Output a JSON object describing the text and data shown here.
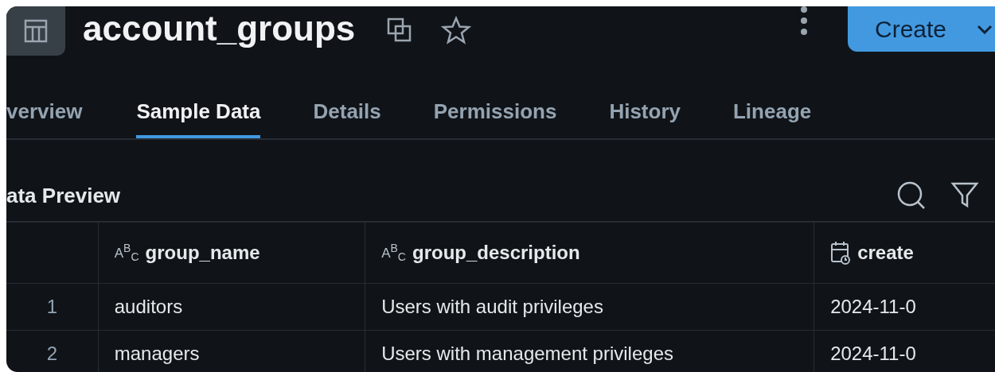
{
  "header": {
    "title": "account_groups",
    "create_button": "Create"
  },
  "tabs": [
    {
      "label": "verview",
      "selected": false
    },
    {
      "label": "Sample Data",
      "selected": true
    },
    {
      "label": "Details",
      "selected": false
    },
    {
      "label": "Permissions",
      "selected": false
    },
    {
      "label": "History",
      "selected": false
    },
    {
      "label": "Lineage",
      "selected": false
    }
  ],
  "section_title": "ata Preview",
  "table": {
    "columns": [
      {
        "label": "group_name",
        "kind": "text",
        "type_glyph": "A$^{B}$$_{C}$"
      },
      {
        "label": "group_description",
        "kind": "text",
        "type_glyph": "A$^{B}$$_{C}$"
      },
      {
        "label": "create",
        "kind": "date"
      }
    ],
    "rows": [
      {
        "index": "1",
        "cells": [
          "auditors",
          "Users with audit privileges",
          "2024-11-0"
        ]
      },
      {
        "index": "2",
        "cells": [
          "managers",
          "Users with management privileges",
          "2024-11-0"
        ]
      }
    ]
  }
}
